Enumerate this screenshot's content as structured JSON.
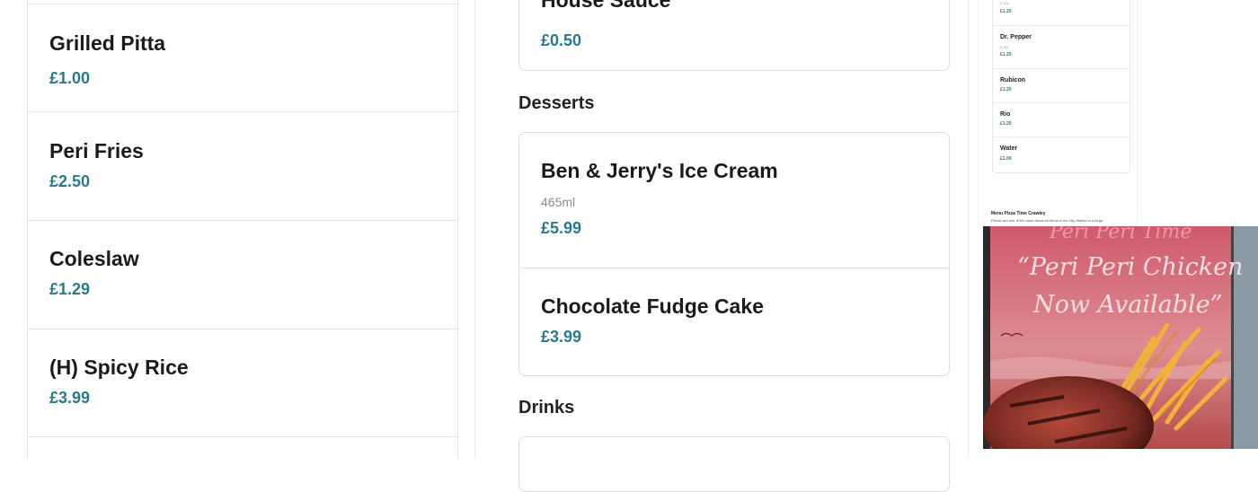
{
  "left_list": {
    "items": [
      {
        "name": "Grilled Pitta",
        "price": "£1.00"
      },
      {
        "name": "Peri Fries",
        "price": "£2.50"
      },
      {
        "name": "Coleslaw",
        "price": "£1.29"
      },
      {
        "name": "(H) Spicy Rice",
        "price": "£3.99"
      }
    ]
  },
  "middle": {
    "top_item": {
      "name": "House Sauce",
      "price": "£0.50"
    },
    "desserts": {
      "title": "Desserts",
      "items": [
        {
          "name": "Ben & Jerry's Ice Cream",
          "desc": "465ml",
          "price": "£5.99"
        },
        {
          "name": "Chocolate Fudge Cake",
          "price": "£3.99"
        }
      ]
    },
    "drinks": {
      "title": "Drinks"
    }
  },
  "mini_menu": {
    "top_fragment": {
      "size": "0.33L",
      "price": "£1.20"
    },
    "items": [
      {
        "name": "Dr. Pepper",
        "size": "0.33L",
        "price": "£1.20"
      },
      {
        "name": "Rubicon",
        "price": "£1.20"
      },
      {
        "name": "Rio",
        "price": "£1.20"
      },
      {
        "name": "Water",
        "price": "£1.00"
      }
    ],
    "heading": "Menu Pizza Time Crawley",
    "paragraph": "Pizzas are one of the most favoured items in the city, thanks to a large"
  },
  "promo": {
    "brand": "Peri Peri Time",
    "headline_1": "“Peri Peri Chicken",
    "headline_2": "Now Available”"
  },
  "colors": {
    "price": "#2a7a8c",
    "border": "#dcdcdc",
    "promo_bg": "#c75a62"
  }
}
